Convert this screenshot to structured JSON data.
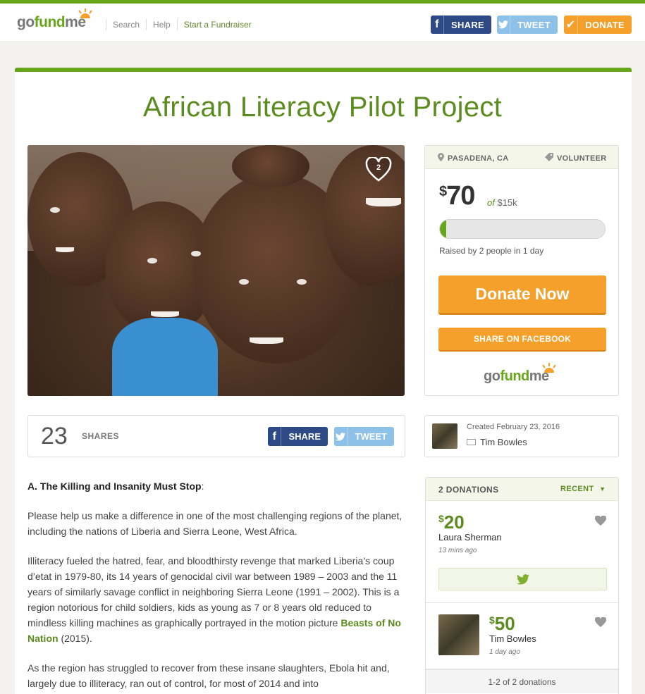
{
  "header": {
    "logo_go": "go",
    "logo_fund": "fund",
    "logo_me": "me",
    "nav": [
      "Search",
      "Help",
      "Start a Fundraiser"
    ],
    "share_label": "SHARE",
    "tweet_label": "TWEET",
    "donate_label": "DONATE"
  },
  "campaign": {
    "title": "African Literacy Pilot Project",
    "hearts": "2",
    "location": "PASADENA, CA",
    "category": "VOLUNTEER",
    "raised_symbol": "$",
    "raised_amount": "70",
    "goal_of": "of",
    "goal": "$15k",
    "progress_fraction": 0.005,
    "raised_by_prefix": "Raised by",
    "raised_by_people": "2",
    "raised_by_middle": "people in",
    "raised_by_days": "1",
    "raised_by_suffix": "day",
    "donate_now": "Donate Now",
    "share_on_facebook": "SHARE ON FACEBOOK"
  },
  "shares": {
    "count": "23",
    "label": "SHARES",
    "share_label": "SHARE",
    "tweet_label": "TWEET"
  },
  "creator": {
    "created": "Created February 23, 2016",
    "name": "Tim Bowles"
  },
  "story": {
    "heading": "A.  The Killing and Insanity Must Stop",
    "heading_colon": ":",
    "p1": "Please help us make a difference in one of the most challenging regions of the planet, including the nations of Liberia and Sierra Leone, West Africa.",
    "p2_before": "Illiteracy fueled the hatred, fear, and bloodthirsty revenge that marked Liberia’s coup d’etat in 1979-80, its 14 years of genocidal civil war between 1989 – 2003 and the 11 years of similarly savage conflict in neighboring Sierra Leone (1991 – 2002). This is a region notorious for child soldiers, kids as young as 7 or 8 years old reduced to mindless killing machines as graphically portrayed in the motion picture ",
    "p2_link": "Beasts of No Nation",
    "p2_after": " (2015).",
    "p3": "As the region has struggled to recover from these insane slaughters, Ebola hit and, largely due to illiteracy, ran out of control, for most of 2014 and into"
  },
  "donations": {
    "count_label": "2 DONATIONS",
    "sort_label": "RECENT",
    "items": [
      {
        "symbol": "$",
        "amount": "20",
        "name": "Laura Sherman",
        "time": "13 mins ago"
      },
      {
        "symbol": "$",
        "amount": "50",
        "name": "Tim Bowles",
        "time": "1 day ago"
      }
    ],
    "footer": "1-2 of 2 donations"
  },
  "colors": {
    "brand_green": "#67a61b",
    "title_green": "#5c8c1f",
    "facebook_blue": "#2d4a86",
    "twitter_blue": "#8ec1e8",
    "donate_orange": "#f5a02a"
  }
}
